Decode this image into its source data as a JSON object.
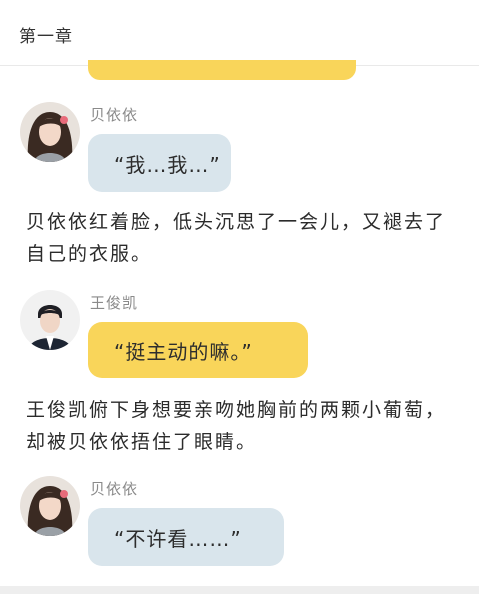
{
  "header": {
    "chapter_title": "第一章"
  },
  "messages": [
    {
      "speaker": "贝依依",
      "text": "“我…我…”"
    },
    {
      "speaker": "王俊凯",
      "text": "“挺主动的嘛。”"
    },
    {
      "speaker": "贝依依",
      "text": "“不许看……”"
    }
  ],
  "narration": [
    "贝依依红着脸，低头沉思了一会儿，又褪去了自己的衣服。",
    "王俊凯俯下身想要亲吻她胸前的两颗小葡萄，却被贝依依捂住了眼睛。"
  ],
  "colors": {
    "grey_bubble": "#d9e5ec",
    "yellow_bubble": "#f9d55a",
    "name_text": "#8a8a8a"
  }
}
